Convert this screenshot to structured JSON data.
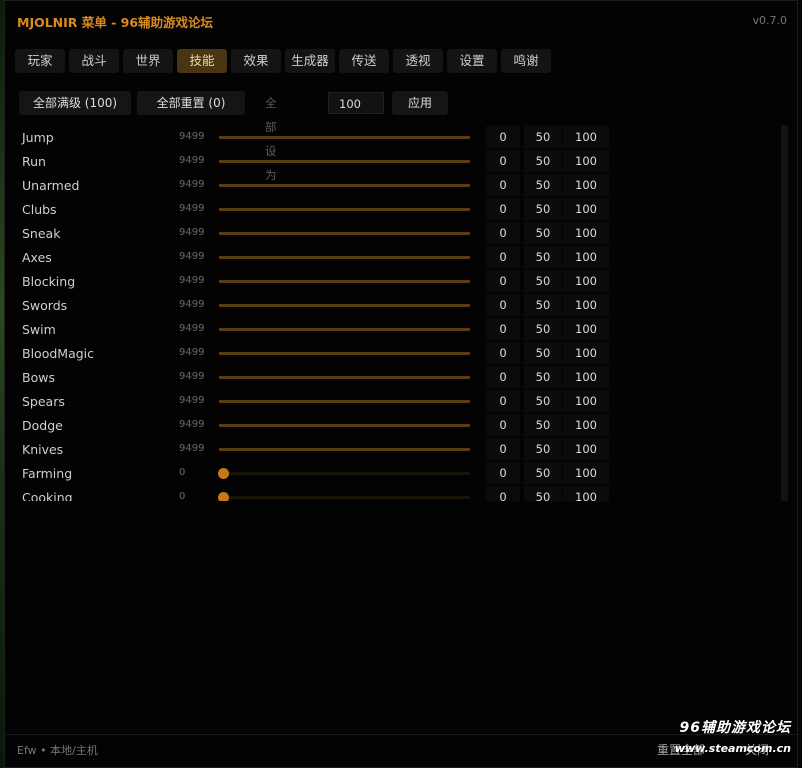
{
  "app": {
    "title": "MJOLNIR 菜单 - 96辅助游戏论坛",
    "version": "v0.7.0"
  },
  "tabs": [
    {
      "label": "玩家",
      "active": false
    },
    {
      "label": "战斗",
      "active": false
    },
    {
      "label": "世界",
      "active": false
    },
    {
      "label": "技能",
      "active": true
    },
    {
      "label": "效果",
      "active": false
    },
    {
      "label": "生成器",
      "active": false
    },
    {
      "label": "传送",
      "active": false
    },
    {
      "label": "透视",
      "active": false
    },
    {
      "label": "设置",
      "active": false
    },
    {
      "label": "鸣谢",
      "active": false
    }
  ],
  "toolbar": {
    "max_all_label": "全部满级 (100)",
    "reset_all_label": "全部重置 (0)",
    "set_all_label": "全部设为",
    "set_all_value": "100",
    "apply_label": "应用"
  },
  "quick_labels": [
    "0",
    "50",
    "100"
  ],
  "skills": [
    {
      "name": "Jump",
      "value": "9499",
      "level": 1.0
    },
    {
      "name": "Run",
      "value": "9499",
      "level": 1.0
    },
    {
      "name": "Unarmed",
      "value": "9499",
      "level": 1.0
    },
    {
      "name": "Clubs",
      "value": "9499",
      "level": 1.0
    },
    {
      "name": "Sneak",
      "value": "9499",
      "level": 1.0
    },
    {
      "name": "Axes",
      "value": "9499",
      "level": 1.0
    },
    {
      "name": "Blocking",
      "value": "9499",
      "level": 1.0
    },
    {
      "name": "Swords",
      "value": "9499",
      "level": 1.0
    },
    {
      "name": "Swim",
      "value": "9499",
      "level": 1.0
    },
    {
      "name": "BloodMagic",
      "value": "9499",
      "level": 1.0
    },
    {
      "name": "Bows",
      "value": "9499",
      "level": 1.0
    },
    {
      "name": "Spears",
      "value": "9499",
      "level": 1.0
    },
    {
      "name": "Dodge",
      "value": "9499",
      "level": 1.0
    },
    {
      "name": "Knives",
      "value": "9499",
      "level": 1.0
    },
    {
      "name": "Farming",
      "value": "0",
      "level": 0
    },
    {
      "name": "Cooking",
      "value": "0",
      "level": 0
    }
  ],
  "status": {
    "player": "Efw",
    "separator": "•",
    "mode": "本地/主机"
  },
  "footer": {
    "reset_all": "重置全部",
    "close": "关闭"
  },
  "watermark": {
    "line1": "96辅助游戏论坛",
    "line2": "www.steamcom.cn"
  },
  "colors": {
    "accent": "#d98b1f",
    "active_tab": "#4a3512",
    "slider_knob": "#c77a13"
  }
}
